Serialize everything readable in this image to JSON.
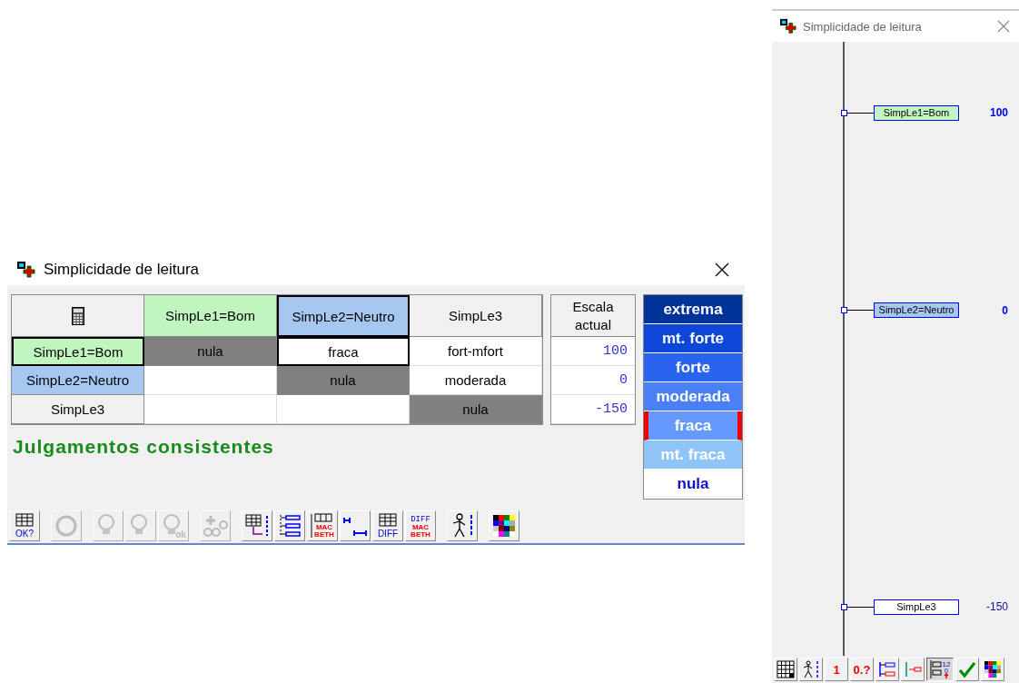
{
  "main_window": {
    "title": "Simplicidade de leitura",
    "matrix": {
      "columns": [
        {
          "label": "SimpLe1=Bom",
          "color": "#c0f5c0",
          "selected": false
        },
        {
          "label": "SimpLe2=Neutro",
          "color": "#a6c8f0",
          "selected": true
        },
        {
          "label": "SimpLe3",
          "color": "#f0f0f0",
          "selected": false
        }
      ],
      "rows": [
        {
          "label": "SimpLe1=Bom",
          "color": "#c0f5c0",
          "selected": true,
          "cells": [
            {
              "text": "nula",
              "kind": "diagonal",
              "selected": false
            },
            {
              "text": "fraca",
              "kind": "judgement",
              "selected": true
            },
            {
              "text": "fort-mfort",
              "kind": "judgement",
              "selected": false
            }
          ]
        },
        {
          "label": "SimpLe2=Neutro",
          "color": "#a6c8f0",
          "selected": false,
          "cells": [
            {
              "kind": "empty",
              "selected": false
            },
            {
              "text": "nula",
              "kind": "diagonal",
              "selected": false
            },
            {
              "text": "moderada",
              "kind": "judgement",
              "selected": false
            }
          ]
        },
        {
          "label": "SimpLe3",
          "color": "#f0f0f0",
          "selected": false,
          "cells": [
            {
              "kind": "empty",
              "selected": false
            },
            {
              "kind": "empty",
              "selected": false
            },
            {
              "text": "nula",
              "kind": "diagonal",
              "selected": false
            }
          ]
        }
      ]
    },
    "scale": {
      "header": "Escala actual",
      "values": [
        "100",
        "0",
        "-150"
      ]
    },
    "status": "Julgamentos consistentes",
    "categories": [
      {
        "label": "extrema",
        "color": "#003399",
        "selected": false
      },
      {
        "label": "mt. forte",
        "color": "#0d47d9",
        "selected": false
      },
      {
        "label": "forte",
        "color": "#2a63f0",
        "selected": false
      },
      {
        "label": "moderada",
        "color": "#4a7ff5",
        "selected": false
      },
      {
        "label": "fraca",
        "color": "#6699ff",
        "selected": true
      },
      {
        "label": "mt. fraca",
        "color": "#8fc4f7",
        "selected": false
      },
      {
        "label": "nula",
        "color": "#ffffff",
        "selected": false
      }
    ],
    "toolbar": [
      [
        {
          "kind": "grid",
          "text": "OK?",
          "disabled": false
        }
      ],
      [
        {
          "kind": "refresh",
          "disabled": true
        }
      ],
      [
        {
          "kind": "bulb",
          "disabled": true
        },
        {
          "kind": "bulb",
          "disabled": true
        },
        {
          "kind": "bulb",
          "text": "ok",
          "disabled": true
        }
      ],
      [
        {
          "kind": "bulbs",
          "disabled": true
        }
      ],
      [
        {
          "kind": "gridarrow",
          "disabled": false
        },
        {
          "kind": "tree",
          "disabled": false
        },
        {
          "kind": "macbeth",
          "text": "MAC BETH",
          "disabled": false
        },
        {
          "kind": "range",
          "disabled": false
        },
        {
          "kind": "grid",
          "text": "DIFF",
          "disabled": false
        },
        {
          "kind": "diff",
          "text": "DIFF",
          "text2": "MAC BETH",
          "disabled": false
        }
      ],
      [
        {
          "kind": "walker",
          "disabled": false
        }
      ],
      [
        {
          "kind": "palette",
          "disabled": false
        }
      ]
    ]
  },
  "scale_window": {
    "title": "Simplicidade de leitura",
    "nodes": [
      {
        "label": "SimpLe1=Bom",
        "value": "100",
        "color": "#c0f5c0",
        "bold": true
      },
      {
        "label": "SimpLe2=Neutro",
        "value": "0",
        "color": "#a6c8f0",
        "bold": true
      },
      {
        "label": "SimpLe3",
        "value": "-150",
        "color": "#ffffff",
        "bold": false
      }
    ],
    "toolbar": [
      {
        "kind": "grid",
        "pressed": false
      },
      {
        "kind": "walker",
        "pressed": false
      },
      {
        "kind": "text",
        "text": "1",
        "pressed": false
      },
      {
        "kind": "text",
        "text": "0.?",
        "pressed": false
      },
      {
        "kind": "tree",
        "pressed": false
      },
      {
        "kind": "range",
        "pressed": false
      },
      {
        "kind": "numbered",
        "text": "12",
        "text2": "0",
        "pressed": true
      },
      {
        "kind": "confirm",
        "pressed": false
      },
      {
        "kind": "palette",
        "pressed": false
      }
    ]
  }
}
